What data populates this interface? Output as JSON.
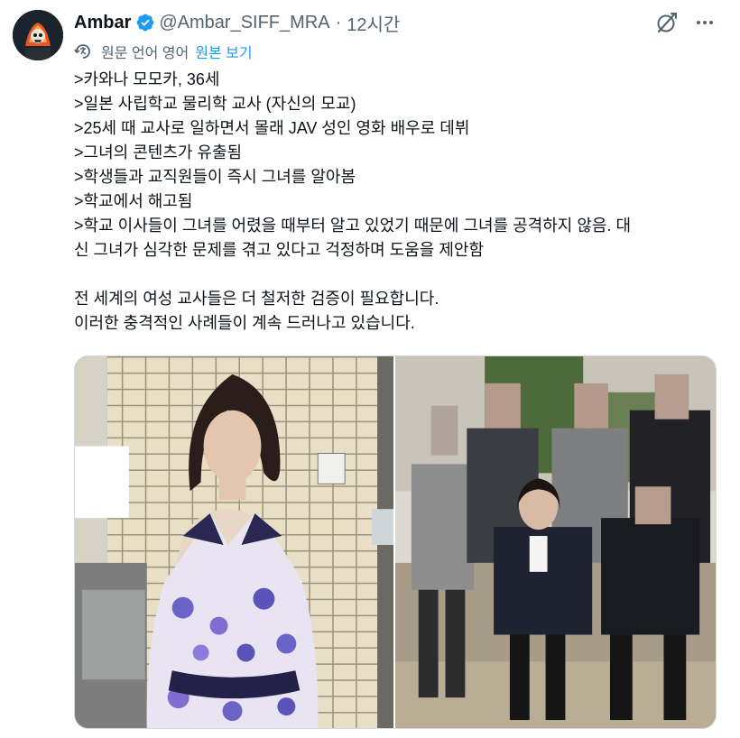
{
  "author": {
    "display_name": "Ambar",
    "handle": "@Ambar_SIFF_MRA",
    "separator": "·",
    "time": "12시간",
    "verified": true
  },
  "translation": {
    "label": "원문 언어 영어",
    "show_original": "원본 보기"
  },
  "tweet": {
    "lines": [
      ">카와나 모모카, 36세",
      ">일본 사립학교 물리학 교사 (자신의 모교)",
      ">25세 때 교사로 일하면서 몰래 JAV 성인 영화 배우로 데뷔",
      ">그녀의 콘텐츠가 유출됨",
      ">학생들과 교직원들이 즉시 그녀를 알아봄",
      ">학교에서 해고됨",
      ">학교 이사들이 그녀를 어렸을 때부터 알고 있었기 때문에 그녀를 공격하지 않음. 대",
      "신 그녀가 심각한 문제를 겪고 있다고 걱정하며 도움을 제안함",
      "",
      "전 세계의 여성 교사들은 더 철저한 검증이 필요합니다.",
      "이러한 충격적인 사례들이 계속 드러나고 있습니다."
    ]
  },
  "media": {
    "images": [
      {
        "subject": "woman in floral halter dress in tiled kitchen"
      },
      {
        "subject": "group photo of people in business suits, faces blurred"
      }
    ]
  },
  "icons": {
    "verified": "verified-badge-icon",
    "grok": "grok-icon",
    "more": "more-icon",
    "translate": "translate-icon"
  },
  "colors": {
    "text_primary": "#0f1419",
    "text_secondary": "#536471",
    "link_blue": "#1d9bf0",
    "verified_blue": "#1d9bf0"
  }
}
